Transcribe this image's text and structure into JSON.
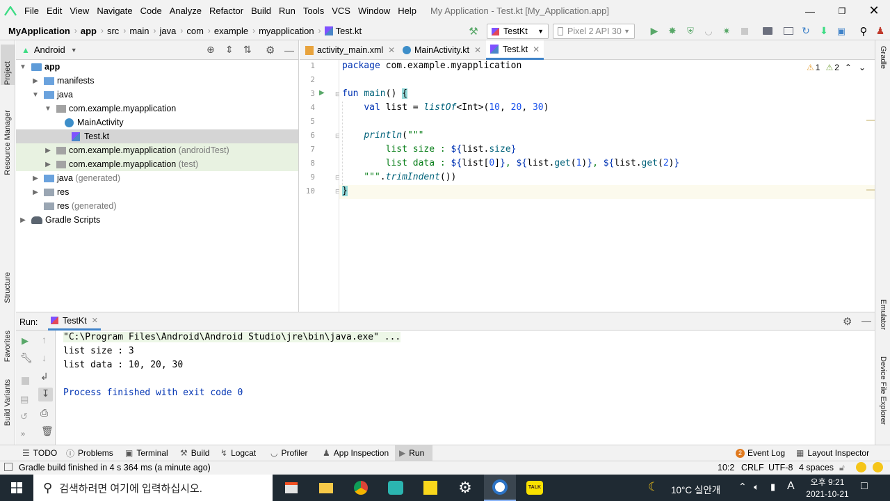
{
  "menubar": {
    "items": [
      "File",
      "Edit",
      "View",
      "Navigate",
      "Code",
      "Analyze",
      "Refactor",
      "Build",
      "Run",
      "Tools",
      "VCS",
      "Window",
      "Help"
    ],
    "window_title": "My Application - Test.kt [My_Application.app]"
  },
  "navbar": {
    "breadcrumb": [
      "MyApplication",
      "app",
      "src",
      "main",
      "java",
      "com",
      "example",
      "myapplication",
      "Test.kt"
    ],
    "run_config": "TestKt",
    "device": "Pixel 2 API 30"
  },
  "left_stripe": {
    "project": "Project",
    "resource_manager": "Resource Manager",
    "structure": "Structure",
    "favorites": "Favorites",
    "build_variants": "Build Variants"
  },
  "right_stripe": {
    "gradle": "Gradle",
    "emulator": "Emulator",
    "device_file_explorer": "Device File Explorer"
  },
  "project_panel": {
    "view_selector": "Android",
    "tree": [
      {
        "label": "app",
        "suffix": "",
        "depth": 0,
        "expanded": true,
        "icon": "module-folder",
        "bold": true
      },
      {
        "label": "manifests",
        "suffix": "",
        "depth": 1,
        "expanded": false,
        "icon": "folder"
      },
      {
        "label": "java",
        "suffix": "",
        "depth": 1,
        "expanded": true,
        "icon": "folder"
      },
      {
        "label": "com.example.myapplication",
        "suffix": "",
        "depth": 2,
        "expanded": true,
        "icon": "package"
      },
      {
        "label": "MainActivity",
        "suffix": "",
        "depth": 3,
        "icon": "kotlin-class"
      },
      {
        "label": "Test.kt",
        "suffix": "",
        "depth": 3,
        "icon": "kotlin-file",
        "selected": true
      },
      {
        "label": "com.example.myapplication",
        "suffix": "(androidTest)",
        "depth": 2,
        "expanded": false,
        "icon": "package",
        "tint": "green"
      },
      {
        "label": "com.example.myapplication",
        "suffix": "(test)",
        "depth": 2,
        "expanded": false,
        "icon": "package",
        "tint": "green"
      },
      {
        "label": "java",
        "suffix": "(generated)",
        "depth": 1,
        "expanded": false,
        "icon": "folder"
      },
      {
        "label": "res",
        "suffix": "",
        "depth": 1,
        "expanded": false,
        "icon": "res-folder"
      },
      {
        "label": "res",
        "suffix": "(generated)",
        "depth": 1,
        "icon": "res-folder"
      },
      {
        "label": "Gradle Scripts",
        "suffix": "",
        "depth": 0,
        "expanded": false,
        "icon": "gradle-elephant"
      }
    ]
  },
  "editor": {
    "tabs": [
      {
        "label": "activity_main.xml",
        "active": false
      },
      {
        "label": "MainActivity.kt",
        "active": false
      },
      {
        "label": "Test.kt",
        "active": true
      }
    ],
    "inspections": {
      "warnings": "1",
      "weak_warnings": "2"
    },
    "line_numbers": [
      "1",
      "2",
      "3",
      "4",
      "5",
      "6",
      "7",
      "8",
      "9",
      "10"
    ]
  },
  "run_panel": {
    "label": "Run:",
    "tab": "TestKt",
    "console": [
      "\"C:\\Program Files\\Android\\Android Studio\\jre\\bin\\java.exe\" ...",
      "list size : 3",
      "list data : 10, 20, 30",
      "",
      "Process finished with exit code 0"
    ]
  },
  "bottom_tools": [
    "TODO",
    "Problems",
    "Terminal",
    "Build",
    "Logcat",
    "Profiler",
    "App Inspection",
    "Run"
  ],
  "bottom_right_tools": {
    "event_log_count": "2",
    "event_log": "Event Log",
    "layout_inspector": "Layout Inspector"
  },
  "statusbar": {
    "message": "Gradle build finished in 4 s 364 ms (a minute ago)",
    "position": "10:2",
    "line_sep": "CRLF",
    "encoding": "UTF-8",
    "indent": "4 spaces"
  },
  "taskbar": {
    "search_placeholder": "검색하려면 여기에 입력하십시오.",
    "weather": "10°C  실안개",
    "ime": "A",
    "time": "오후 9:21",
    "date": "2021-10-21"
  },
  "colors": {
    "accent": "#4083c9",
    "kotlin": "#7f52ff",
    "run_green": "#59a869",
    "selection": "#d5d5d5",
    "test_bg": "#e8f2e1"
  }
}
